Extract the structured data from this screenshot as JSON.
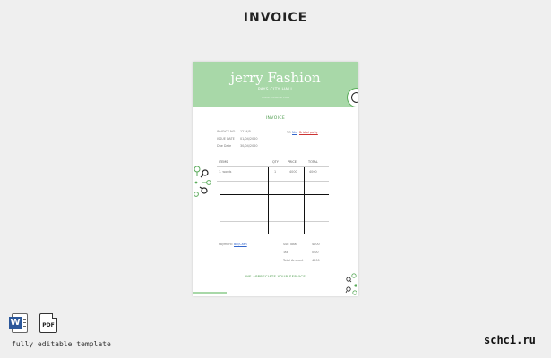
{
  "heading": "INVOICE",
  "invoice": {
    "brand": "jerry Fashion",
    "subtitle": "PAYS CITY HALL",
    "tagline": "WWW.FASHION.COM",
    "doc_title": "INVOICE",
    "meta": [
      {
        "label": "INVOICE NO",
        "value": "1234/5"
      },
      {
        "label": "ISSUE DATE",
        "value": "01/04/2020"
      },
      {
        "label": "Due Date",
        "value": "30/04/2020"
      }
    ],
    "bill_to_label": "TO",
    "bill_to_name": "Nic",
    "bill_to_link": "Bristol party",
    "columns": [
      "ITEMS",
      "QTY",
      "PRICE",
      "TOTAL"
    ],
    "rows": [
      {
        "item": "1. words",
        "qty": "1",
        "price": "4000",
        "total": "4000"
      }
    ],
    "payment_label": "Payment:",
    "payment_value": "Bill/Cash",
    "totals": [
      {
        "label": "Sub Total",
        "value": "4000"
      },
      {
        "label": "Tax",
        "value": "0.00"
      },
      {
        "label": "Total Amount",
        "value": "4000"
      }
    ],
    "thanks": "WE APPRECIATE YOUR SERVICE"
  },
  "footer": {
    "word_icon": "word-doc-icon",
    "pdf_icon": "pdf-doc-icon",
    "pdf_label": "PDF",
    "caption": "fully editable template",
    "watermark": "schci.ru"
  },
  "colors": {
    "accent_green": "#a8d8a8",
    "title_green": "#4a9a4a",
    "word_blue": "#2b579a"
  }
}
